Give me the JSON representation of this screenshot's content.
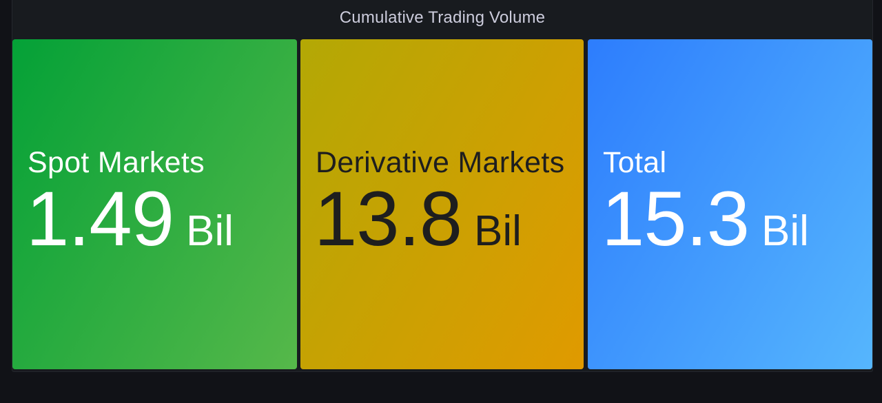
{
  "panel": {
    "title": "Cumulative Trading Volume"
  },
  "stats": [
    {
      "label": "Spot Markets",
      "value": "1.49",
      "unit": "Bil",
      "gradient_start": "#04a137",
      "gradient_end": "#56b84a",
      "text_color": "#ffffff"
    },
    {
      "label": "Derivative Markets",
      "value": "13.8",
      "unit": "Bil",
      "gradient_start": "#b3a805",
      "gradient_end": "#e09a00",
      "text_color": "#1e1e1e"
    },
    {
      "label": "Total",
      "value": "15.3",
      "unit": "Bil",
      "gradient_start": "#2d7dfd",
      "gradient_end": "#56b6fd",
      "text_color": "#ffffff"
    }
  ]
}
